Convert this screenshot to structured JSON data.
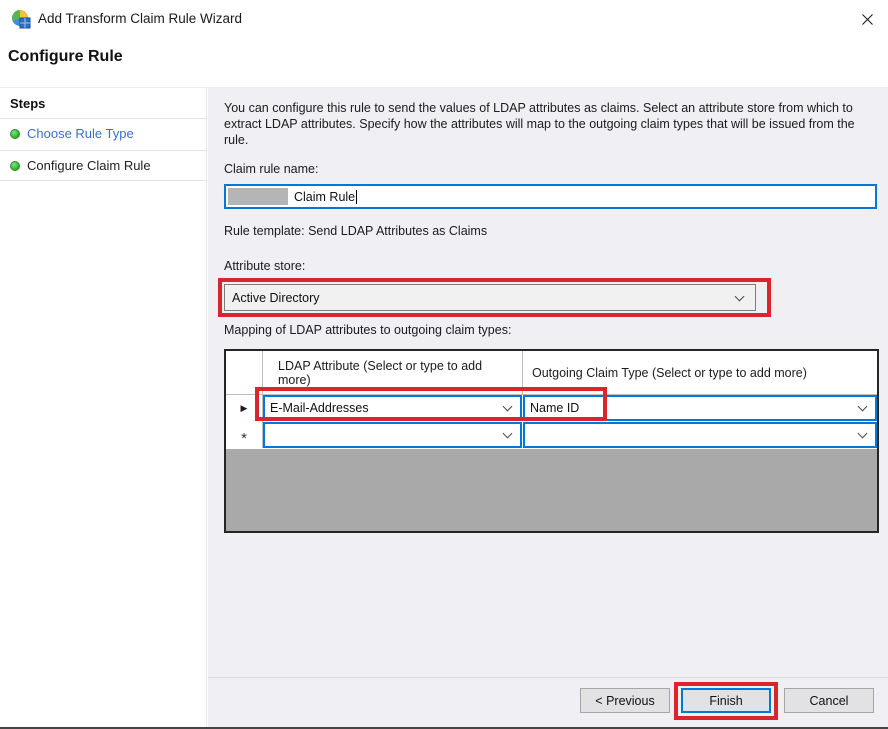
{
  "window": {
    "title": "Add Transform Claim Rule Wizard"
  },
  "heading": "Configure Rule",
  "sidebar": {
    "header": "Steps",
    "items": [
      {
        "label": "Choose Rule Type",
        "state": "done"
      },
      {
        "label": "Configure Claim Rule",
        "state": "current"
      }
    ]
  },
  "main": {
    "description": "You can configure this rule to send the values of LDAP attributes as claims. Select an attribute store from which to extract LDAP attributes. Specify how the attributes will map to the outgoing claim types that will be issued from the rule.",
    "claim_rule_name": {
      "label": "Claim rule name:",
      "value": "Claim Rule",
      "value_prefix_redacted": true
    },
    "rule_template": "Rule template: Send LDAP Attributes as Claims",
    "attribute_store": {
      "label": "Attribute store:",
      "value": "Active Directory"
    },
    "mapping": {
      "label": "Mapping of LDAP attributes to outgoing claim types:",
      "columns": [
        "LDAP Attribute (Select or type to add more)",
        "Outgoing Claim Type (Select or type to add more)"
      ],
      "rows": [
        {
          "marker": "▶",
          "ldap_attribute": "E-Mail-Addresses",
          "outgoing_claim_type": "Name ID"
        },
        {
          "marker": "*",
          "ldap_attribute": "",
          "outgoing_claim_type": ""
        }
      ]
    }
  },
  "footer": {
    "previous_label": "< Previous",
    "finish_label": "Finish",
    "cancel_label": "Cancel"
  },
  "colors": {
    "annotation_red": "#d9252c",
    "focus_blue": "#0078d7",
    "link_blue": "#3a6fd1",
    "step_dot_green": "#35b935",
    "content_panel_gray": "#f0eff3",
    "grid_filler_gray": "#a9a9a9"
  }
}
